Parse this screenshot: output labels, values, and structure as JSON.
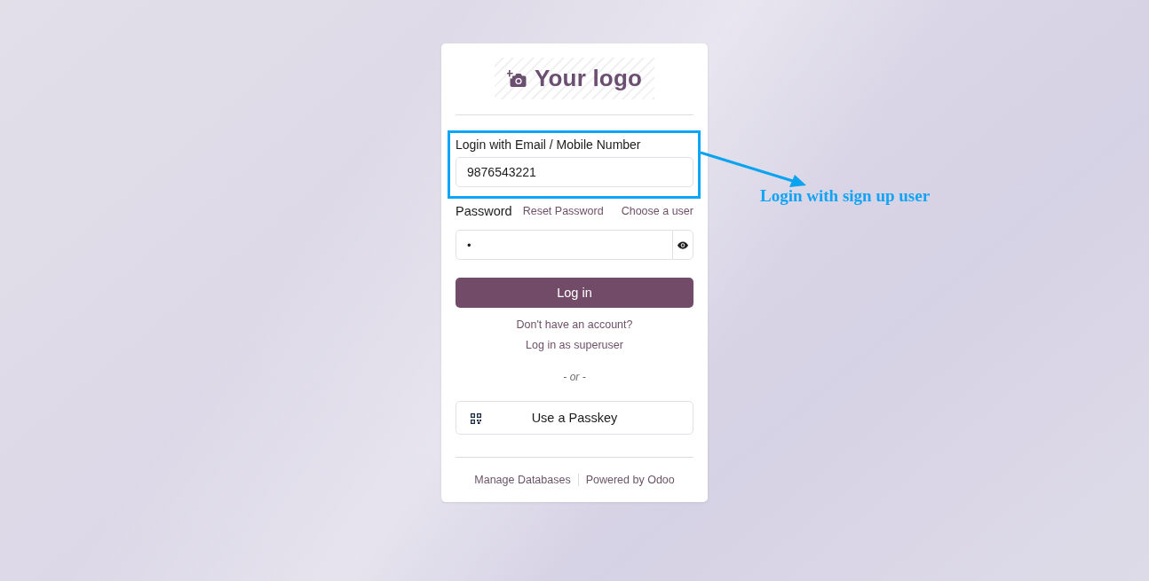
{
  "logo": {
    "text": "Your logo"
  },
  "login_field": {
    "label": "Login with Email / Mobile Number",
    "value": "9876543221",
    "highlighted": true
  },
  "password_field": {
    "label": "Password",
    "links": [
      "Reset Password",
      "Choose a user"
    ],
    "value": "•"
  },
  "login_button": "Log in",
  "links": [
    "Don't have an account?",
    "Log in as superuser"
  ],
  "separator": "- or -",
  "passkey_button": "Use a Passkey",
  "footer_links": [
    "Manage Databases",
    "Powered by Odoo"
  ],
  "annotation": {
    "text": "Login with sign up user"
  }
}
